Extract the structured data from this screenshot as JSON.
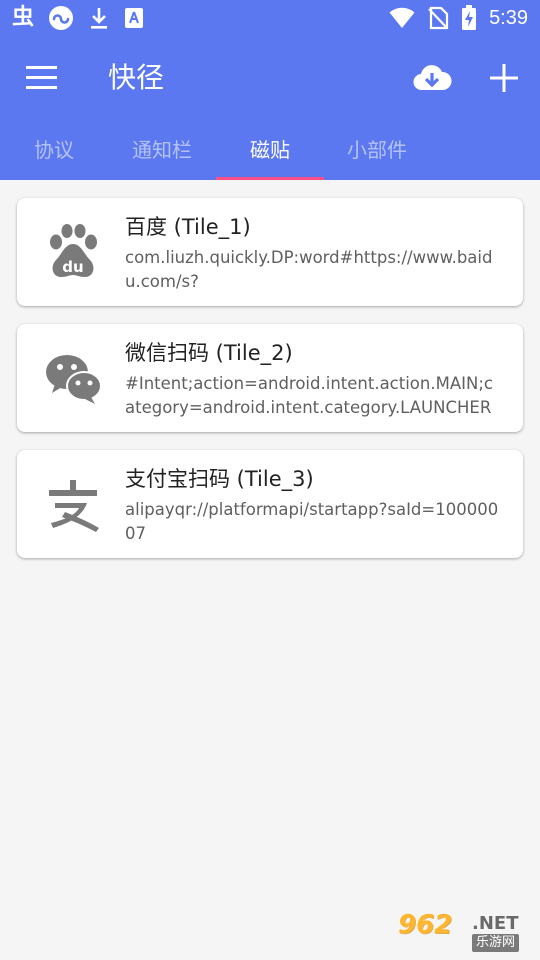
{
  "status_bar": {
    "time": "5:39",
    "left_icons": [
      "app-notification-icon",
      "game-notification-icon",
      "download-icon",
      "store-icon"
    ],
    "right_icons": [
      "wifi-icon",
      "no-sim-icon",
      "battery-charging-icon"
    ],
    "left_glyph": "虫"
  },
  "toolbar": {
    "title": "快径",
    "menu_icon": "hamburger-menu-icon",
    "cloud_icon": "cloud-download-icon",
    "add_icon": "plus-icon"
  },
  "tabs": [
    {
      "label": "协议",
      "active": false
    },
    {
      "label": "通知栏",
      "active": false
    },
    {
      "label": "磁贴",
      "active": true
    },
    {
      "label": "小部件",
      "active": false
    }
  ],
  "tiles": [
    {
      "title": "百度 (Tile_1)",
      "description": "com.liuzh.quickly.DP:word#https://www.baidu.com/s?",
      "icon": "baidu-paw-icon"
    },
    {
      "title": "微信扫码 (Tile_2)",
      "description": "#Intent;action=android.intent.action.MAIN;category=android.intent.category.LAUNCHER",
      "icon": "wechat-icon"
    },
    {
      "title": "支付宝扫码 (Tile_3)",
      "description": "alipayqr://platformapi/startapp?saId=10000007",
      "icon": "alipay-icon"
    }
  ],
  "watermark": {
    "number": "962",
    "suffix": ".NET",
    "subtitle": "乐游网"
  },
  "colors": {
    "appbar": "#5b78f0",
    "indicator": "#ff4f8b",
    "background": "#f5f5f5",
    "icon_gray": "#7a7a7a"
  }
}
